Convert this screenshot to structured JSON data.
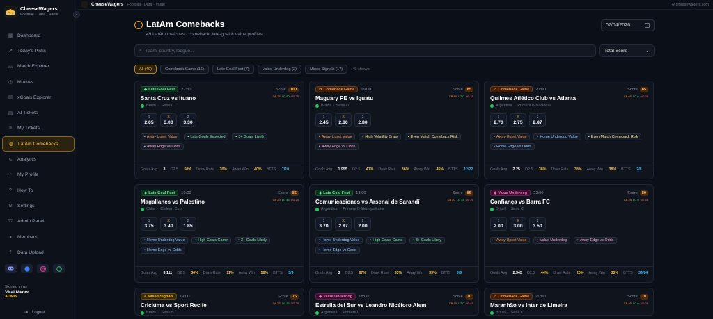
{
  "brand": {
    "name": "CheeseWagers",
    "sub": "Football · Data · Value",
    "collapse": "‹"
  },
  "topbar": {
    "brand": "CheeseWagers",
    "sub": "Football · Data · Value",
    "link": "cheesewagers.com"
  },
  "nav": [
    {
      "label": "Dashboard",
      "icon": "grid-icon"
    },
    {
      "label": "Today's Picks",
      "icon": "trend-icon"
    },
    {
      "label": "Match Explorer",
      "icon": "calendar-icon"
    },
    {
      "label": "Motives",
      "icon": "target-icon"
    },
    {
      "label": "xGoals Explorer",
      "icon": "chart-icon"
    },
    {
      "label": "AI Tickets",
      "icon": "ticket-icon"
    },
    {
      "label": "My Tickets",
      "icon": "list-icon"
    },
    {
      "label": "LatAm Comebacks",
      "icon": "globe-icon",
      "active": true
    },
    {
      "label": "Analytics",
      "icon": "analytics-icon"
    },
    {
      "label": "My Profile",
      "icon": "user-icon"
    },
    {
      "label": "How To",
      "icon": "help-icon"
    },
    {
      "label": "Settings",
      "icon": "gear-icon"
    },
    {
      "label": "Admin Panel",
      "icon": "shield-icon"
    },
    {
      "label": "Members",
      "icon": "users-icon"
    },
    {
      "label": "Data Upload",
      "icon": "upload-icon"
    }
  ],
  "user": {
    "signed_in": "Signed in as",
    "name": "Viral Meow",
    "role": "ADMIN",
    "logout": "Logout"
  },
  "page": {
    "title": "LatAm Comebacks",
    "subtitle": "49 LatAm matches · comeback, late-goal & value profiles",
    "date": "07/04/2026"
  },
  "search": {
    "placeholder": "Team, country, league..."
  },
  "sort": {
    "value": "Total Score"
  },
  "filters": [
    "All (49)",
    "Comeback Game (16)",
    "Late Goal Fest (7)",
    "Value Underdog (2)",
    "Mixed Signals (17)"
  ],
  "shown": "49 shown",
  "labels": {
    "score": "Score",
    "goals_avg": "Goals Avg",
    "o25": "O2.5",
    "draw_rate": "Draw Rate",
    "away_win": "Away Win",
    "btts": "BTTS",
    "o1": "1",
    "ox": "X",
    "o2": "2"
  },
  "cards": [
    {
      "profile": "Late Goal Fest",
      "ptype": "fest",
      "time": "22:30",
      "score": "100",
      "mini": [
        "CB 25",
        "LG 80",
        "UD 25"
      ],
      "teams": "Santa Cruz vs Ituano",
      "country": "Brazil",
      "league": "Serie C",
      "odds": [
        "2.05",
        "3.00",
        "3.30"
      ],
      "chips": [
        {
          "t": "Away Upset Value",
          "c": "o"
        },
        {
          "t": "Late Goals Expected",
          "c": "g"
        },
        {
          "t": "3+ Goals Likely",
          "c": "g"
        },
        {
          "t": "Away Edge vs Odds",
          "c": "p"
        }
      ],
      "stats": {
        "ga": "3",
        "o25": "50%",
        "dr": "30%",
        "aw": "40%",
        "btts": "7/10"
      }
    },
    {
      "profile": "Comeback Game",
      "ptype": "cg",
      "time": "19:00",
      "score": "85",
      "mini": [
        "CB 80",
        "LG 0",
        "UD 25"
      ],
      "teams": "Maguary PE vs Iguatu",
      "country": "Brazil",
      "league": "Serie D",
      "odds": [
        "2.45",
        "2.80",
        "2.80"
      ],
      "chips": [
        {
          "t": "Away Upset Value",
          "c": "o"
        },
        {
          "t": "High Volatility Draw",
          "c": "y"
        },
        {
          "t": "Even Match Comeback Risk",
          "c": "y"
        },
        {
          "t": "Away Edge vs Odds",
          "c": "p"
        }
      ],
      "stats": {
        "ga": "1.955",
        "o25": "41%",
        "dr": "36%",
        "aw": "45%",
        "btts": "12/22"
      }
    },
    {
      "profile": "Comeback Game",
      "ptype": "cg",
      "time": "21:00",
      "score": "85",
      "mini": [
        "CB 65",
        "LG 0",
        "UD 20"
      ],
      "teams": "Quilmes Atlético Club vs Atlanta",
      "country": "Argentina",
      "league": "Primera B Nacional",
      "odds": [
        "2.70",
        "2.75",
        "2.87"
      ],
      "chips": [
        {
          "t": "Away Upset Value",
          "c": "o"
        },
        {
          "t": "Home Underdog Value",
          "c": "b"
        },
        {
          "t": "Even Match Comeback Risk",
          "c": "y"
        },
        {
          "t": "Home Edge vs Odds",
          "c": "b"
        }
      ],
      "stats": {
        "ga": "2.25",
        "o25": "38%",
        "dr": "38%",
        "aw": "38%",
        "btts": "2/8"
      }
    },
    {
      "profile": "Late Goal Fest",
      "ptype": "fest",
      "time": "19:00",
      "score": "85",
      "mini": [
        "CB 20",
        "LG 45",
        "UD 20"
      ],
      "teams": "Magallanes vs Palestino",
      "country": "Chile",
      "league": "Chilean Cup",
      "odds": [
        "3.75",
        "3.40",
        "1.85"
      ],
      "chips": [
        {
          "t": "Home Underdog Value",
          "c": "b"
        },
        {
          "t": "High Goals Game",
          "c": "g"
        },
        {
          "t": "3+ Goals Likely",
          "c": "g"
        },
        {
          "t": "Home Edge vs Odds",
          "c": "b"
        }
      ],
      "stats": {
        "ga": "3.111",
        "o25": "56%",
        "dr": "11%",
        "aw": "56%",
        "btts": "5/9"
      }
    },
    {
      "profile": "Late Goal Fest",
      "ptype": "fest",
      "time": "18:00",
      "score": "85",
      "mini": [
        "CB 20",
        "LG 45",
        "UD 20"
      ],
      "teams": "Comunicaciones vs Arsenal de Sarandí",
      "country": "Argentina",
      "league": "Primera B Metropolitana",
      "odds": [
        "3.70",
        "2.87",
        "2.00"
      ],
      "chips": [
        {
          "t": "Home Underdog Value",
          "c": "b"
        },
        {
          "t": "High Goals Game",
          "c": "g"
        },
        {
          "t": "3+ Goals Likely",
          "c": "g"
        },
        {
          "t": "Home Edge vs Odds",
          "c": "b"
        }
      ],
      "stats": {
        "ga": "3",
        "o25": "67%",
        "dr": "33%",
        "aw": "33%",
        "btts": "3/6"
      }
    },
    {
      "profile": "Value Underdog",
      "ptype": "vu",
      "time": "22:00",
      "score": "80",
      "mini": [
        "CB 25",
        "LG 0",
        "UD 55"
      ],
      "teams": "Confiança vs Barra FC",
      "country": "Brazil",
      "league": "Serie C",
      "odds": [
        "2.00",
        "3.00",
        "3.50"
      ],
      "chips": [
        {
          "t": "Away Upset Value",
          "c": "o"
        },
        {
          "t": "Value Underdog",
          "c": "p"
        },
        {
          "t": "Away Edge vs Odds",
          "c": "p"
        }
      ],
      "stats": {
        "ga": "2.345",
        "o25": "44%",
        "dr": "20%",
        "aw": "35%",
        "btts": "39/84"
      }
    },
    {
      "profile": "Mixed Signals",
      "ptype": "ms",
      "time": "19:00",
      "score": "75",
      "mini": [
        "CB 25",
        "LG 25",
        "UD 25"
      ],
      "teams": "Criciúma vs Sport Recife",
      "country": "Brazil",
      "league": "Serie B",
      "odds": [],
      "chips": [],
      "stats": {}
    },
    {
      "profile": "Value Underdog",
      "ptype": "vu",
      "time": "18:00",
      "score": "70",
      "mini": [
        "CB 10",
        "LG 0",
        "UD 65"
      ],
      "teams": "Estrella del Sur vs Leandro Nicéforo Alem",
      "country": "Argentina",
      "league": "Primera C",
      "odds": [],
      "chips": [],
      "stats": {}
    },
    {
      "profile": "Comeback Game",
      "ptype": "cg",
      "time": "20:00",
      "score": "70",
      "mini": [
        "CB 45",
        "LG 0",
        "UD 25"
      ],
      "teams": "Maranhão vs Inter de Limeira",
      "country": "Brazil",
      "league": "Serie C",
      "odds": [],
      "chips": [],
      "stats": {}
    }
  ]
}
